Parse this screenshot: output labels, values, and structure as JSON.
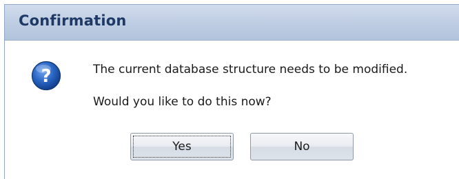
{
  "dialog": {
    "title": "Confirmation",
    "icon": "question-icon",
    "message_line1": "The current database structure needs to be modified.",
    "message_line2": "Would you like to do this now?",
    "buttons": {
      "yes_label": "Yes",
      "no_label": "No",
      "focused": "yes"
    }
  },
  "colors": {
    "title_text": "#1e3966",
    "titlebar_bg": "#c1cfe4",
    "icon_blue": "#1f5bb5"
  }
}
